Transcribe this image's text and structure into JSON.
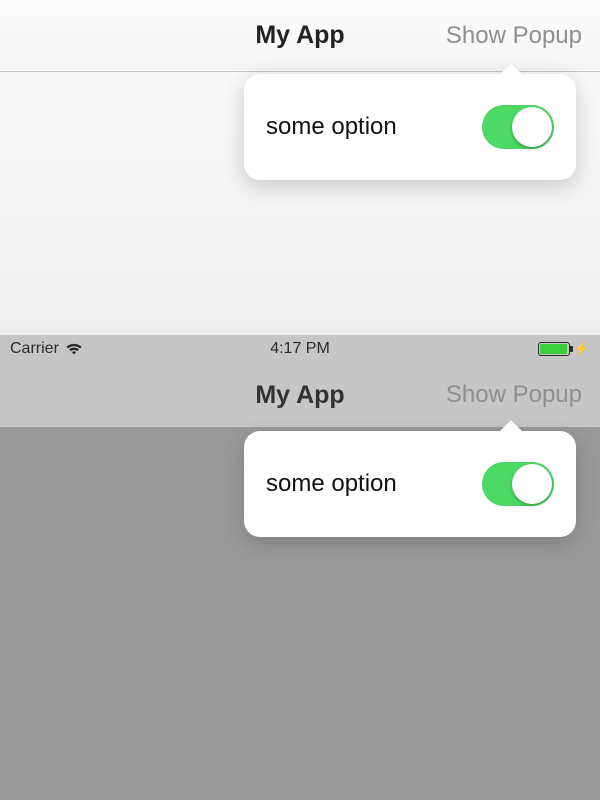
{
  "top": {
    "nav": {
      "title": "My App",
      "right_button": "Show Popup"
    },
    "popover": {
      "option_label": "some option",
      "toggle_on": true
    }
  },
  "bottom": {
    "statusbar": {
      "carrier": "Carrier",
      "time": "4:17 PM",
      "charging": true
    },
    "nav": {
      "title": "My App",
      "right_button": "Show Popup"
    },
    "popover": {
      "option_label": "some option",
      "toggle_on": true
    }
  },
  "colors": {
    "toggle_on": "#4cd964",
    "nav_button_disabled": "#8e8e93"
  }
}
